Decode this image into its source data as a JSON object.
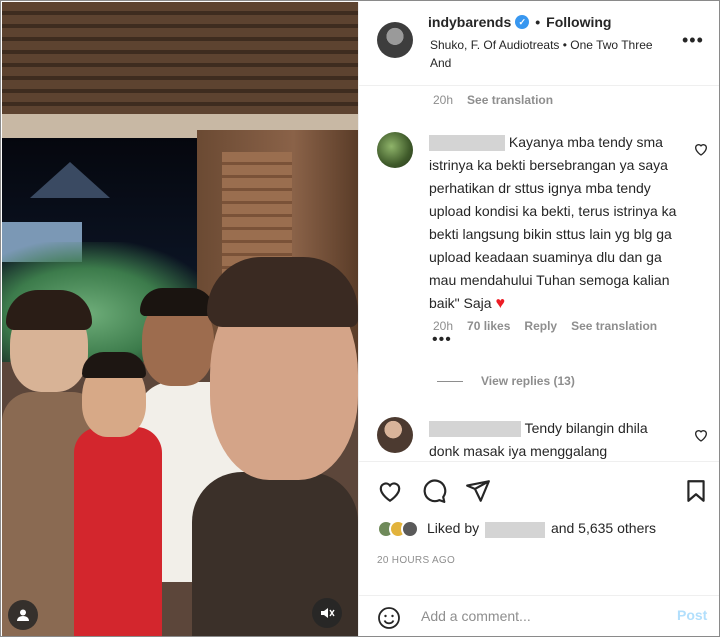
{
  "post": {
    "username": "indybarends",
    "following_label": "Following",
    "audio": "Shuko, F. Of Audiotreats • One Two Three And"
  },
  "comments": {
    "first_meta": {
      "time": "20h",
      "translate": "See translation"
    },
    "c1": {
      "text": "Kayanya mba tendy sma istrinya ka bekti bersebrangan ya saya perhatikan dr sttus ignya mba tendy upload kondisi ka bekti, terus istrinya ka bekti langsung bikin sttus lain yg blg ga upload keadaan suaminya dlu dan ga mau mendahului Tuhan semoga kalian baik\" Saja",
      "time": "20h",
      "likes": "70 likes",
      "reply": "Reply",
      "translate": "See translation"
    },
    "view_replies": "View replies (13)",
    "c2": {
      "text": "Tendy bilangin dhila donk masak iya menggalang"
    }
  },
  "likes": {
    "prefix": "Liked by",
    "suffix": "and 5,635 others"
  },
  "time_ago": "20 HOURS AGO",
  "comment_box": {
    "placeholder": "Add a comment...",
    "post_label": "Post"
  },
  "colors": {
    "verified": "#3897f0",
    "heart": "#ed1c24",
    "post_disabled": "#b2dffc"
  },
  "icons": [
    "user-tag-icon",
    "mute-icon",
    "verified-icon",
    "more-icon",
    "heart-icon",
    "comment-icon",
    "share-icon",
    "bookmark-icon",
    "emoji-icon"
  ]
}
